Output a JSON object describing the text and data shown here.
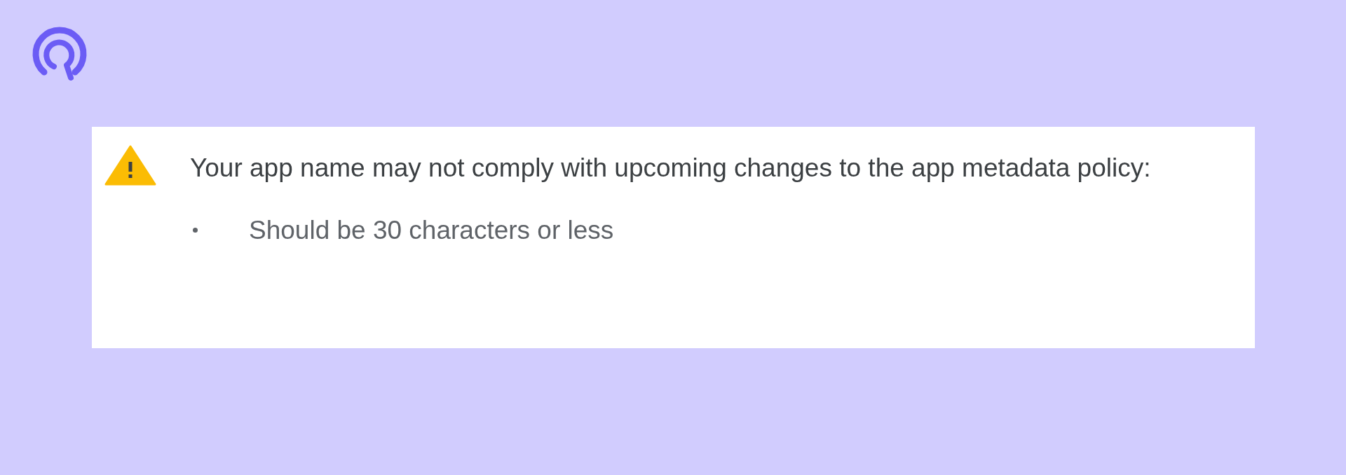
{
  "warning": {
    "message": "Your app name may not comply with upcoming changes to the app metadata policy:",
    "bullets": [
      "Should be 30 characters or less"
    ]
  }
}
